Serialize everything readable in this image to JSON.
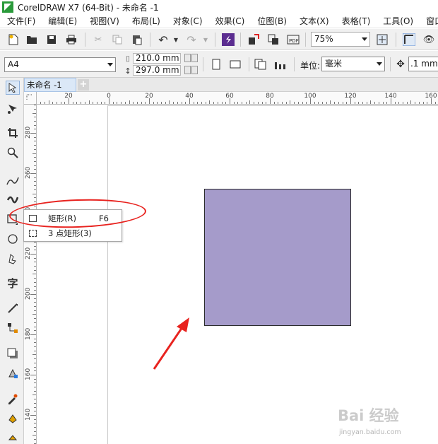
{
  "window": {
    "title": "CorelDRAW X7 (64-Bit) - 未命名 -1"
  },
  "menu": [
    "文件(F)",
    "编辑(E)",
    "视图(V)",
    "布局(L)",
    "对象(C)",
    "效果(C)",
    "位图(B)",
    "文本(X)",
    "表格(T)",
    "工具(O)",
    "窗口"
  ],
  "toolbar": {
    "zoom_value": "75%"
  },
  "propertybar": {
    "page_size": "A4",
    "width": "210.0 mm",
    "height": "297.0 mm",
    "unit_label": "单位:",
    "unit_value": "毫米",
    "nudge": ".1 mm"
  },
  "document": {
    "tab_label": "未命名 -1",
    "add_tab": "+"
  },
  "rulers": {
    "horizontal_labels": [
      "20",
      "0",
      "20",
      "40",
      "60",
      "80",
      "100",
      "120",
      "140",
      "160"
    ],
    "vertical_labels": [
      "280",
      "260",
      "240",
      "220",
      "200",
      "180",
      "160",
      "140"
    ]
  },
  "flyout": {
    "items": [
      {
        "label": "矩形(R)",
        "shortcut": "F6"
      },
      {
        "label": "3 点矩形(3)",
        "shortcut": ""
      }
    ]
  },
  "shape": {
    "fill_color": "#a59bca",
    "outline_color": "#2b2b2b"
  },
  "annotation": {
    "color": "#e8231f"
  },
  "watermark": {
    "logo": "Bai 经验",
    "url": "jingyan.baidu.com"
  }
}
